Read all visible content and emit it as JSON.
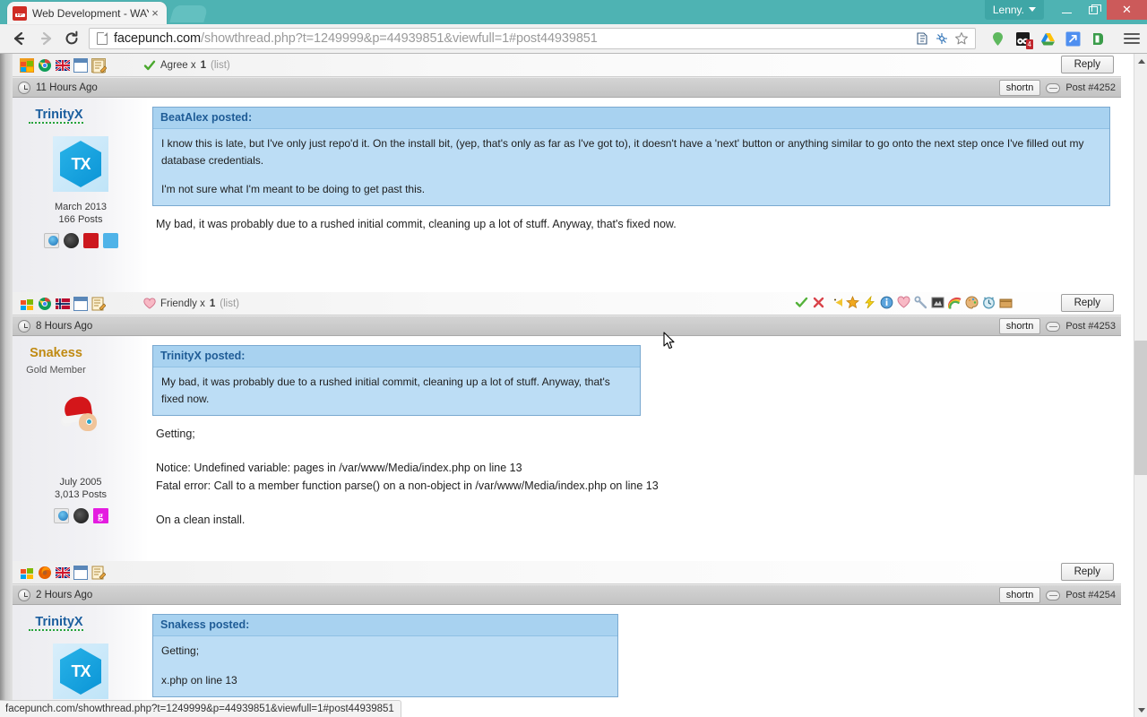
{
  "browser": {
    "tab": {
      "title": "Web Development - WAY",
      "favicon_name": "facepunch-favicon",
      "close_label": "×"
    },
    "user_badge": {
      "label": "Lenny."
    },
    "window_controls": {
      "minimize": "–",
      "maximize": "❐",
      "close": "×"
    },
    "nav": {
      "back": "←",
      "forward": "→",
      "reload": "↻"
    },
    "omnibox": {
      "host": "facepunch.com",
      "path": "/showthread.php?t=1249999&p=44939851&viewfull=1#post44939851",
      "full_url": "facepunch.com/showthread.php?t=1249999&p=44939851&viewfull=1#post44939851"
    },
    "status_tooltip": "facepunch.com/showthread.php?t=1249999&p=44939851&viewfull=1#post44939851"
  },
  "colors": {
    "chrome_frame": "#4eb3b3",
    "quote_bg": "#bcddf5",
    "quote_head_bg": "#a8d2f0",
    "username_blue": "#1b5e9e",
    "username_gold": "#c08a12",
    "postbar_bg": "#c9c9c9",
    "close_btn": "#cc5a5a"
  },
  "posts": [
    {
      "id": "post-4252-footer",
      "footer": {
        "icons": [
          "windows-icon",
          "chrome-icon",
          "flag-uk-icon",
          "calendar-icon",
          "edit-icon"
        ],
        "rating": {
          "icon": "check-icon",
          "label": "Agree x",
          "count": "1",
          "list": "(list)"
        },
        "reply_label": "Reply"
      }
    }
  ],
  "post_bars": [
    {
      "time": "11 Hours Ago",
      "shortn": "shortn",
      "post_no": "Post #4252"
    },
    {
      "time": "8 Hours Ago",
      "shortn": "shortn",
      "post_no": "Post #4253"
    },
    {
      "time": "2 Hours Ago",
      "shortn": "shortn",
      "post_no": "Post #4254"
    }
  ],
  "post_trinityx_1": {
    "user": {
      "name": "TrinityX",
      "avatar_text": "TX",
      "join_date": "March 2013",
      "post_count": "166 Posts",
      "social": [
        "homepage-icon",
        "steam-icon",
        "youtube-icon",
        "twitter-icon"
      ]
    },
    "quote": {
      "header": "BeatAlex posted:",
      "paragraphs": [
        "I know this is late, but I've only just repo'd it. On the install bit, (yep, that's only as far as I've got to), it doesn't have a 'next' button or anything similar to go onto the next step once I've filled out my database credentials.",
        "I'm not sure what I'm meant to be doing to get past this."
      ]
    },
    "body": "My bad, it was probably due to a rushed initial commit, cleaning up a lot of stuff. Anyway, that's fixed now.",
    "footer": {
      "icons": [
        "windows-icon",
        "chrome-icon",
        "flag-norway-icon",
        "calendar-icon",
        "edit-icon"
      ],
      "rating": {
        "icon": "heart-icon",
        "label": "Friendly x",
        "count": "1",
        "list": "(list)"
      },
      "rate_icons": [
        "agree-icon",
        "disagree-icon",
        "funny-icon",
        "winner-icon",
        "zing-icon",
        "informative-icon",
        "friendly-icon",
        "useful-icon",
        "programming-king-icon",
        "optimistic-icon",
        "artistic-icon",
        "late-icon",
        "box-icon"
      ],
      "reply_label": "Reply"
    }
  },
  "post_snakess": {
    "user": {
      "name": "Snakess",
      "title": "Gold Member",
      "avatar_name": "santa-avatar",
      "join_date": "July 2005",
      "post_count": "3,013 Posts",
      "social": [
        "homepage-icon",
        "steam-icon",
        "gmod-icon"
      ]
    },
    "quote": {
      "header": "TrinityX posted:",
      "paragraphs": [
        "My bad, it was probably due to a rushed initial commit, cleaning up a lot of stuff. Anyway, that's fixed now."
      ]
    },
    "body_lines": [
      "Getting;",
      "Notice: Undefined variable: pages in /var/www/Media/index.php on line 13",
      "Fatal error: Call to a member function parse() on a non-object in /var/www/Media/index.php on line 13",
      "On a clean install."
    ],
    "footer": {
      "icons": [
        "windows-icon",
        "firefox-icon",
        "flag-uk-icon",
        "calendar-icon",
        "edit-icon"
      ],
      "reply_label": "Reply"
    }
  },
  "post_trinityx_2": {
    "user": {
      "name": "TrinityX",
      "avatar_text": "TX"
    },
    "quote": {
      "header": "Snakess posted:",
      "paragraphs": [
        "Getting;"
      ],
      "clipped_line": "x.php on line 13"
    }
  }
}
